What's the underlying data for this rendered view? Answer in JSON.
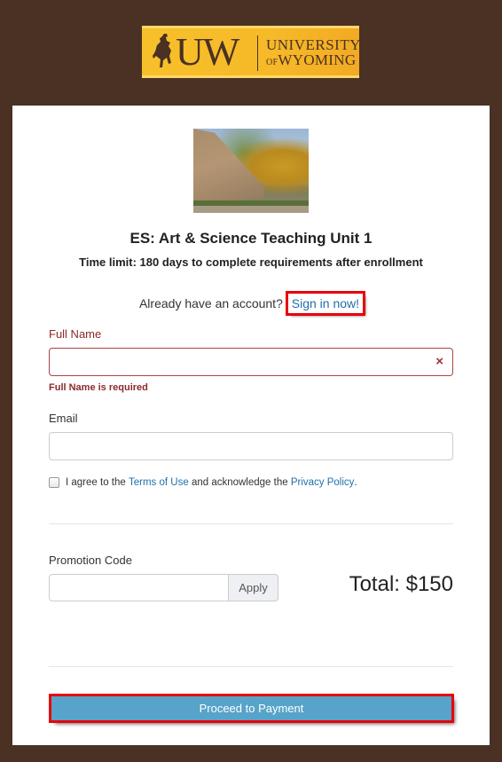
{
  "branding": {
    "logo_mark": "UW",
    "logo_line1": "UNIVERSITY",
    "logo_line2_prefix": "OF",
    "logo_line2": "WYOMING",
    "icon": "bucking-horse-rider-icon",
    "colors": {
      "gold": "#f6b928",
      "brown": "#4a3124"
    }
  },
  "course": {
    "image_alt": "University of Wyoming stone wall sign with autumn trees",
    "title": "ES: Art & Science Teaching Unit 1",
    "time_limit": "Time limit: 180 days to complete requirements after enrollment"
  },
  "signin": {
    "prompt": "Already have an account?",
    "link_label": "Sign in now!"
  },
  "form": {
    "full_name": {
      "label": "Full Name",
      "value": "",
      "error": "Full Name is required",
      "clear_icon": "×"
    },
    "email": {
      "label": "Email",
      "value": ""
    },
    "agree": {
      "checked": false,
      "text_before": "I agree to the ",
      "terms_link": "Terms of Use",
      "text_middle": " and acknowledge the ",
      "privacy_link": "Privacy Policy",
      "text_after": "."
    },
    "promo": {
      "label": "Promotion Code",
      "value": "",
      "apply_label": "Apply"
    },
    "total": "Total: $150",
    "submit_label": "Proceed to Payment"
  },
  "colors": {
    "link": "#1f6fa8",
    "error": "#a94442",
    "primary_button": "#57a3c9",
    "highlight": "#e8000b"
  }
}
